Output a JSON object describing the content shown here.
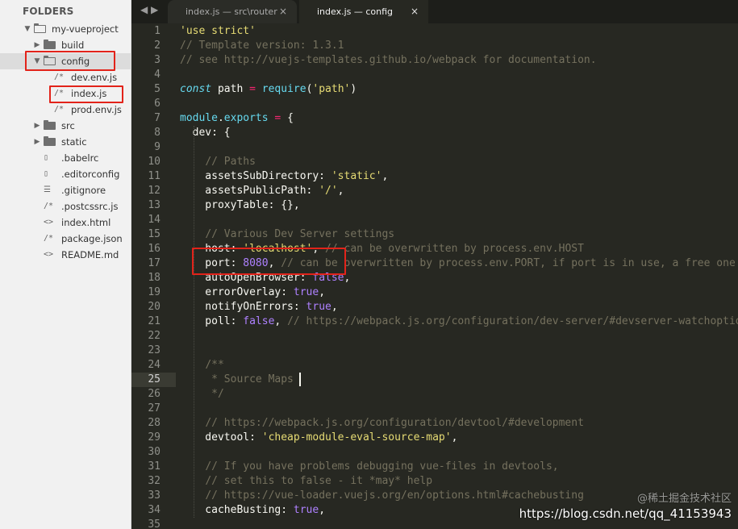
{
  "sidebar": {
    "title": "FOLDERS",
    "tree": [
      {
        "label": "my-vueproject",
        "kind": "folder",
        "state": "open",
        "depth": 0
      },
      {
        "label": "build",
        "kind": "folder",
        "state": "closed",
        "depth": 1
      },
      {
        "label": "config",
        "kind": "folder",
        "state": "open",
        "depth": 1,
        "selected": true,
        "highlighted": true
      },
      {
        "label": "dev.env.js",
        "kind": "file",
        "glyph": "/*",
        "depth": 2
      },
      {
        "label": "index.js",
        "kind": "file",
        "glyph": "/*",
        "depth": 2,
        "highlighted": true
      },
      {
        "label": "prod.env.js",
        "kind": "file",
        "glyph": "/*",
        "depth": 2
      },
      {
        "label": "src",
        "kind": "folder",
        "state": "closed",
        "depth": 1
      },
      {
        "label": "static",
        "kind": "folder",
        "state": "closed",
        "depth": 1
      },
      {
        "label": ".babelrc",
        "kind": "file",
        "glyph": "▯",
        "depth": 1
      },
      {
        "label": ".editorconfig",
        "kind": "file",
        "glyph": "▯",
        "depth": 1
      },
      {
        "label": ".gitignore",
        "kind": "file",
        "glyph": "☰",
        "depth": 1
      },
      {
        "label": ".postcssrc.js",
        "kind": "file",
        "glyph": "/*",
        "depth": 1
      },
      {
        "label": "index.html",
        "kind": "file",
        "glyph": "<>",
        "depth": 1
      },
      {
        "label": "package.json",
        "kind": "file",
        "glyph": "/*",
        "depth": 1
      },
      {
        "label": "README.md",
        "kind": "file",
        "glyph": "<>",
        "depth": 1
      }
    ]
  },
  "tabs": [
    {
      "label": "index.js — src\\router",
      "active": false,
      "close": "×"
    },
    {
      "label": "index.js — config",
      "active": true,
      "close": "×"
    }
  ],
  "nav": {
    "back": "◀",
    "forward": "▶"
  },
  "editor": {
    "current_line": 25,
    "lines": [
      [
        [
          "str",
          "'use strict'"
        ]
      ],
      [
        [
          "com",
          "// Template version: 1.3.1"
        ]
      ],
      [
        [
          "com",
          "// see http://vuejs-templates.github.io/webpack for documentation."
        ]
      ],
      [],
      [
        [
          "kw",
          "const"
        ],
        [
          "txt",
          " path "
        ],
        [
          "op",
          "="
        ],
        [
          "txt",
          " "
        ],
        [
          "fn",
          "require"
        ],
        [
          "txt",
          "("
        ],
        [
          "str",
          "'path'"
        ],
        [
          "txt",
          ")"
        ]
      ],
      [],
      [
        [
          "fn",
          "module"
        ],
        [
          "txt",
          "."
        ],
        [
          "fn",
          "exports"
        ],
        [
          "txt",
          " "
        ],
        [
          "op",
          "="
        ],
        [
          "txt",
          " {"
        ]
      ],
      [
        [
          "txt",
          "  dev: {"
        ]
      ],
      [],
      [
        [
          "txt",
          "    "
        ],
        [
          "com",
          "// Paths"
        ]
      ],
      [
        [
          "txt",
          "    assetsSubDirectory: "
        ],
        [
          "str",
          "'static'"
        ],
        [
          "txt",
          ","
        ]
      ],
      [
        [
          "txt",
          "    assetsPublicPath: "
        ],
        [
          "str",
          "'/'"
        ],
        [
          "txt",
          ","
        ]
      ],
      [
        [
          "txt",
          "    proxyTable: {},"
        ]
      ],
      [],
      [
        [
          "txt",
          "    "
        ],
        [
          "com",
          "// Various Dev Server settings"
        ]
      ],
      [
        [
          "txt",
          "    host: "
        ],
        [
          "str",
          "'localhost'"
        ],
        [
          "txt",
          ", "
        ],
        [
          "com",
          "// can be overwritten by process.env.HOST"
        ]
      ],
      [
        [
          "txt",
          "    port: "
        ],
        [
          "num",
          "8080"
        ],
        [
          "txt",
          ", "
        ],
        [
          "com",
          "// can be overwritten by process.env.PORT, if port is in use, a free one will be determined"
        ]
      ],
      [
        [
          "txt",
          "    autoOpenBrowser: "
        ],
        [
          "num",
          "false"
        ],
        [
          "txt",
          ","
        ]
      ],
      [
        [
          "txt",
          "    errorOverlay: "
        ],
        [
          "num",
          "true"
        ],
        [
          "txt",
          ","
        ]
      ],
      [
        [
          "txt",
          "    notifyOnErrors: "
        ],
        [
          "num",
          "true"
        ],
        [
          "txt",
          ","
        ]
      ],
      [
        [
          "txt",
          "    poll: "
        ],
        [
          "num",
          "false"
        ],
        [
          "txt",
          ", "
        ],
        [
          "com",
          "// https://webpack.js.org/configuration/dev-server/#devserver-watchoptions-"
        ]
      ],
      [],
      [],
      [
        [
          "txt",
          "    "
        ],
        [
          "com",
          "/**"
        ]
      ],
      [
        [
          "txt",
          "     "
        ],
        [
          "com",
          "* Source Maps"
        ]
      ],
      [
        [
          "txt",
          "     "
        ],
        [
          "com",
          "*/"
        ]
      ],
      [],
      [
        [
          "txt",
          "    "
        ],
        [
          "com",
          "// https://webpack.js.org/configuration/devtool/#development"
        ]
      ],
      [
        [
          "txt",
          "    devtool: "
        ],
        [
          "str",
          "'cheap-module-eval-source-map'"
        ],
        [
          "txt",
          ","
        ]
      ],
      [],
      [
        [
          "txt",
          "    "
        ],
        [
          "com",
          "// If you have problems debugging vue-files in devtools,"
        ]
      ],
      [
        [
          "txt",
          "    "
        ],
        [
          "com",
          "// set this to false - it *may* help"
        ]
      ],
      [
        [
          "txt",
          "    "
        ],
        [
          "com",
          "// https://vue-loader.vuejs.org/en/options.html#cachebusting"
        ]
      ],
      [
        [
          "txt",
          "    cacheBusting: "
        ],
        [
          "num",
          "true"
        ],
        [
          "txt",
          ","
        ]
      ],
      []
    ]
  },
  "watermark": {
    "line1": "@稀土掘金技术社区",
    "line2": "https://blog.csdn.net/qq_41153943"
  },
  "colors": {
    "sidebar_bg": "#f1f1f1",
    "editor_bg": "#272822",
    "highlight_box": "#e2231a"
  }
}
